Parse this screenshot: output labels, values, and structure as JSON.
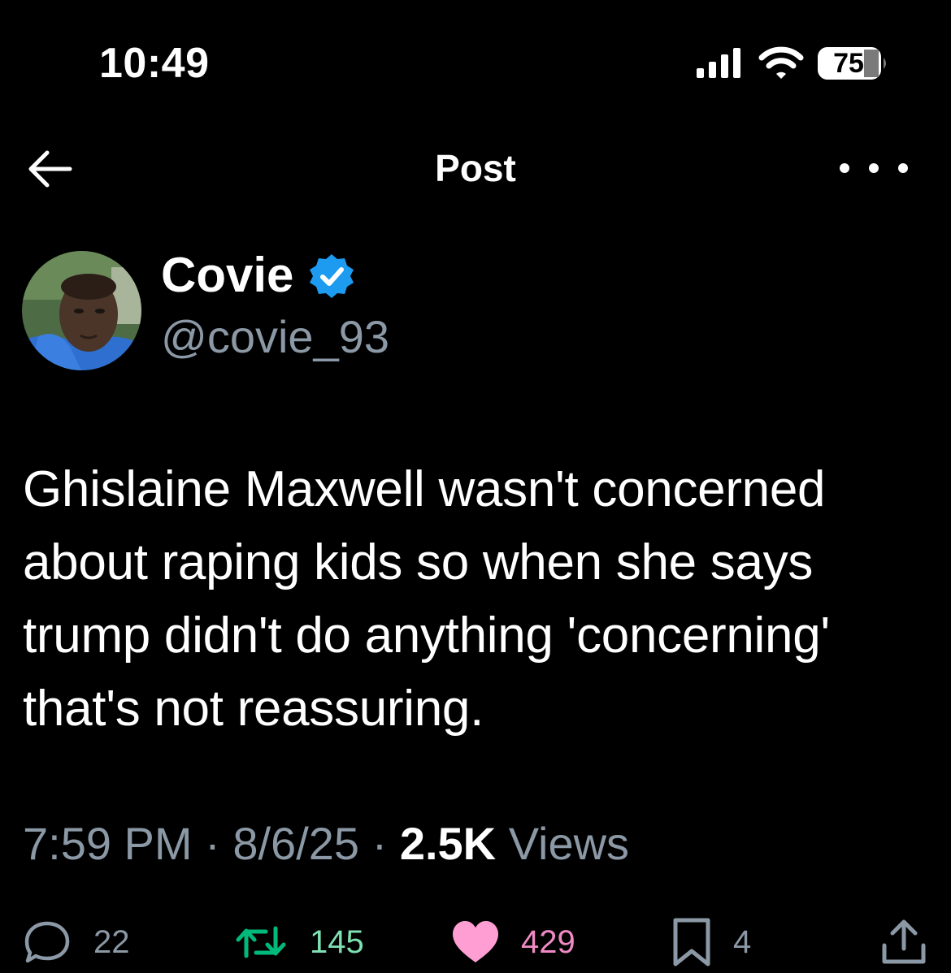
{
  "status_bar": {
    "time": "10:49",
    "battery_level": "75"
  },
  "header": {
    "title": "Post",
    "back_icon": "arrow-left-icon",
    "more_icon": "more-horizontal-icon"
  },
  "author": {
    "display_name": "Covie",
    "handle": "@covie_93",
    "verified": true,
    "verified_color": "#1d9bf0"
  },
  "tweet": {
    "text_lines": [
      "Ghislaine Maxwell wasn't concerned",
      "about raping kids so when she says",
      "trump didn't do anything 'concerning'",
      "that's not reassuring."
    ],
    "time": "7:59 PM",
    "date": "8/6/25",
    "views_count": "2.5K",
    "views_label": "Views"
  },
  "actions": {
    "replies": "22",
    "reposts": "145",
    "likes": "429",
    "bookmarks": "4",
    "repost_color": "#00ba7c",
    "like_color": "#f91880"
  }
}
